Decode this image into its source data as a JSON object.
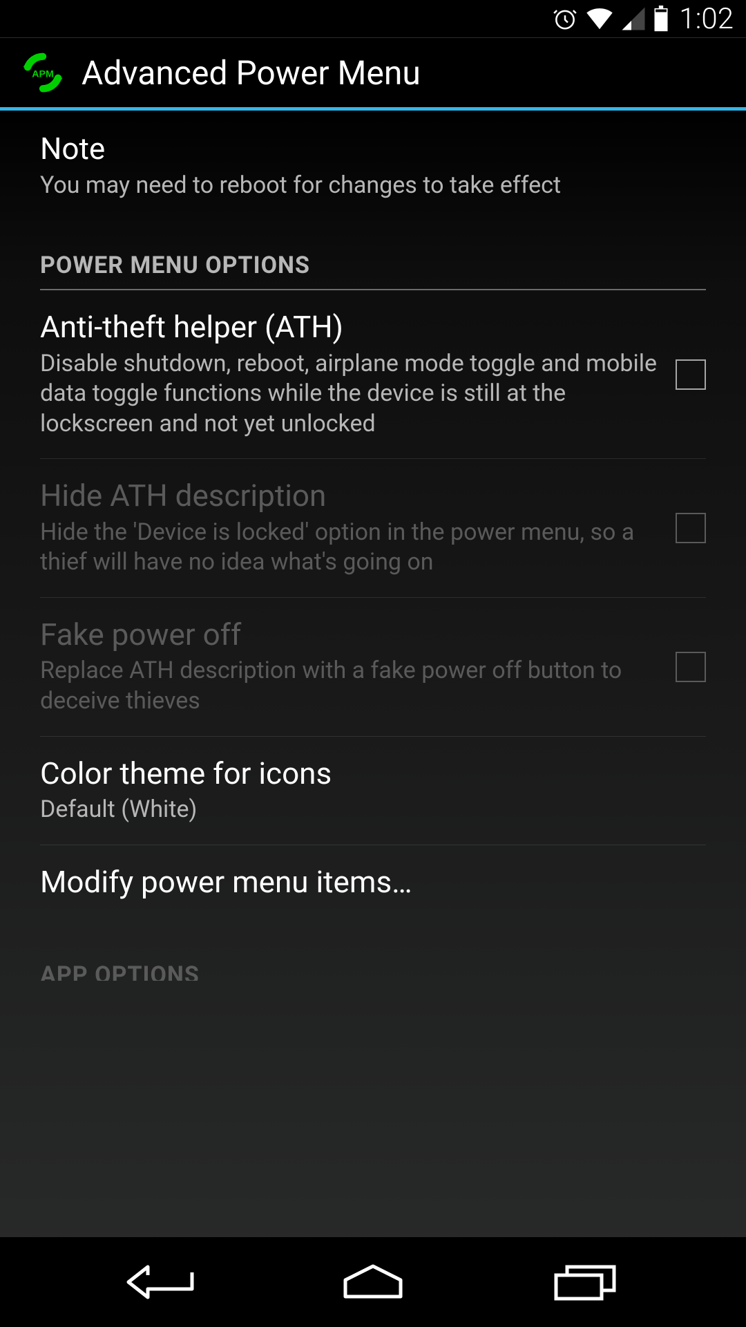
{
  "status": {
    "time": "1:02"
  },
  "header": {
    "title": "Advanced Power Menu"
  },
  "note": {
    "title": "Note",
    "summary": "You may need to reboot for changes to take effect"
  },
  "sections": {
    "power_menu_options": "POWER MENU OPTIONS",
    "app_options": "APP OPTIONS"
  },
  "prefs": {
    "ath": {
      "title": "Anti-theft helper (ATH)",
      "summary": "Disable shutdown, reboot, airplane mode toggle and mobile data toggle functions while the device is still at the lockscreen and not yet unlocked"
    },
    "hide_ath": {
      "title": "Hide ATH description",
      "summary": "Hide the 'Device is locked' option in the power menu, so a thief will have no idea what's going on"
    },
    "fake_power_off": {
      "title": "Fake power off",
      "summary": "Replace ATH description with a fake power off button to deceive thieves"
    },
    "color_theme": {
      "title": "Color theme for icons",
      "summary": "Default (White)"
    },
    "modify": {
      "title": "Modify power menu items…"
    }
  }
}
